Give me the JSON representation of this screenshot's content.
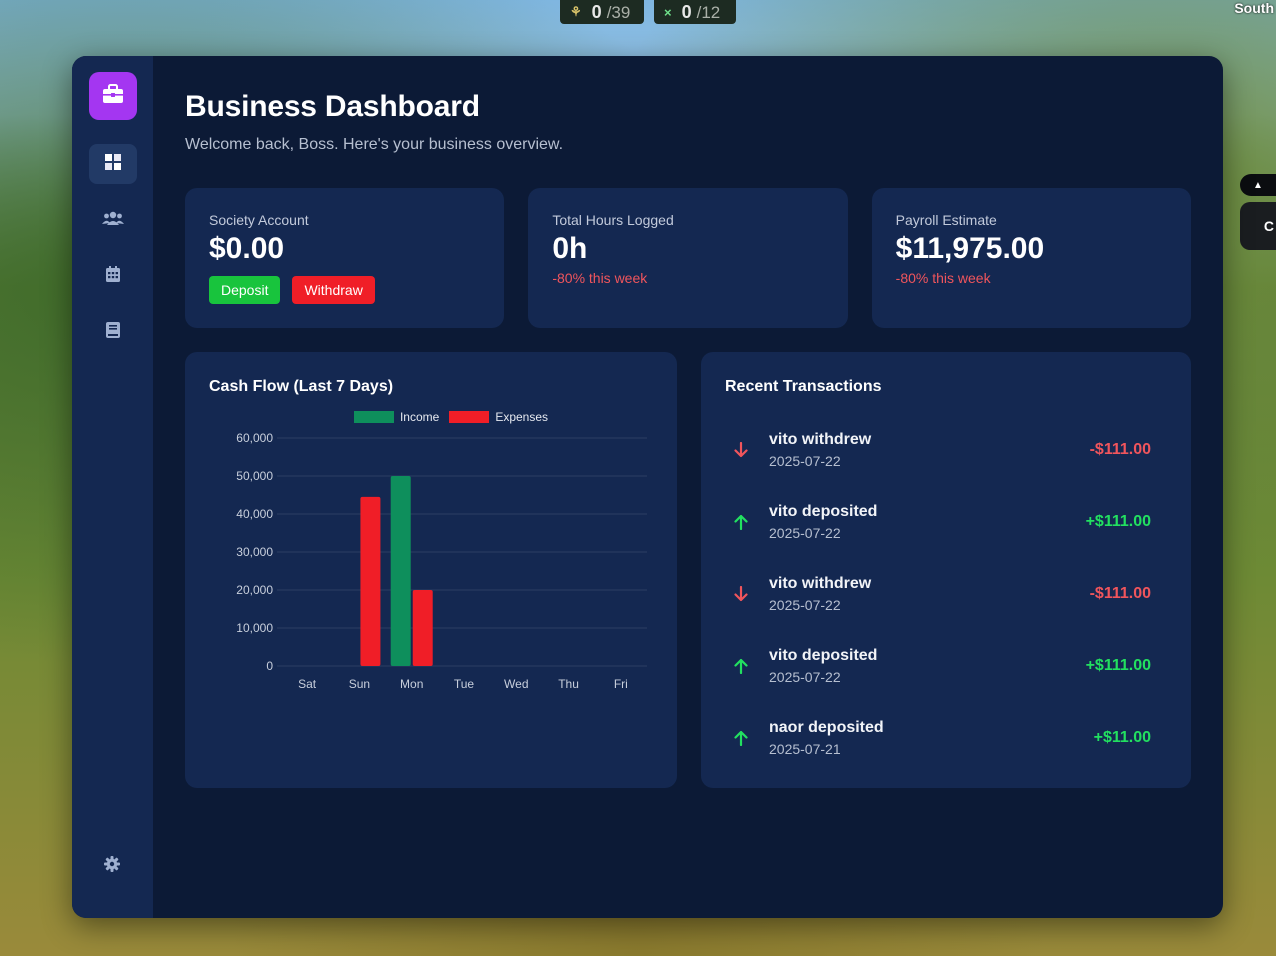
{
  "hud": {
    "counter1": {
      "value": "0",
      "total": "/39"
    },
    "counter2": {
      "value": "0",
      "total": "/12"
    },
    "direction": "South",
    "side_letter": "C"
  },
  "colors": {
    "accent": "#a436f1",
    "income": "#0e8f5c",
    "expenses": "#f01e27",
    "negative": "#f0555c",
    "positive": "#22e060",
    "card_bg": "#142851",
    "app_bg": "#0c1a36"
  },
  "sidebar": {
    "logo_icon": "briefcase-icon",
    "items": [
      {
        "icon": "dashboard-icon",
        "active": true
      },
      {
        "icon": "users-icon",
        "active": false
      },
      {
        "icon": "calendar-icon",
        "active": false
      },
      {
        "icon": "book-icon",
        "active": false
      }
    ],
    "settings_icon": "gear-icon"
  },
  "header": {
    "title": "Business Dashboard",
    "subtitle": "Welcome back, Boss. Here's your business overview."
  },
  "stats": {
    "society": {
      "label": "Society Account",
      "value": "$0.00",
      "deposit_label": "Deposit",
      "withdraw_label": "Withdraw"
    },
    "hours": {
      "label": "Total Hours Logged",
      "value": "0h",
      "change": "-80% this week"
    },
    "payroll": {
      "label": "Payroll Estimate",
      "value": "$11,975.00",
      "change": "-80% this week"
    }
  },
  "cashflow": {
    "title": "Cash Flow (Last 7 Days)"
  },
  "chart_data": {
    "type": "bar",
    "title": "Cash Flow (Last 7 Days)",
    "categories": [
      "Sat",
      "Sun",
      "Mon",
      "Tue",
      "Wed",
      "Thu",
      "Fri"
    ],
    "series": [
      {
        "name": "Income",
        "values": [
          0,
          0,
          50000,
          0,
          0,
          0,
          0
        ]
      },
      {
        "name": "Expenses",
        "values": [
          0,
          44500,
          20000,
          0,
          0,
          0,
          0
        ]
      }
    ],
    "ylim": [
      0,
      60000
    ],
    "yticks": [
      "0",
      "10,000",
      "20,000",
      "30,000",
      "40,000",
      "50,000",
      "60,000"
    ],
    "grid": true,
    "legend_position": "top"
  },
  "transactions": {
    "title": "Recent Transactions",
    "items": [
      {
        "title": "vito withdrew",
        "date": "2025-07-22",
        "amount": "-$111.00",
        "type": "withdraw"
      },
      {
        "title": "vito deposited",
        "date": "2025-07-22",
        "amount": "+$111.00",
        "type": "deposit"
      },
      {
        "title": "vito withdrew",
        "date": "2025-07-22",
        "amount": "-$111.00",
        "type": "withdraw"
      },
      {
        "title": "vito deposited",
        "date": "2025-07-22",
        "amount": "+$111.00",
        "type": "deposit"
      },
      {
        "title": "naor deposited",
        "date": "2025-07-21",
        "amount": "+$11.00",
        "type": "deposit"
      }
    ]
  }
}
